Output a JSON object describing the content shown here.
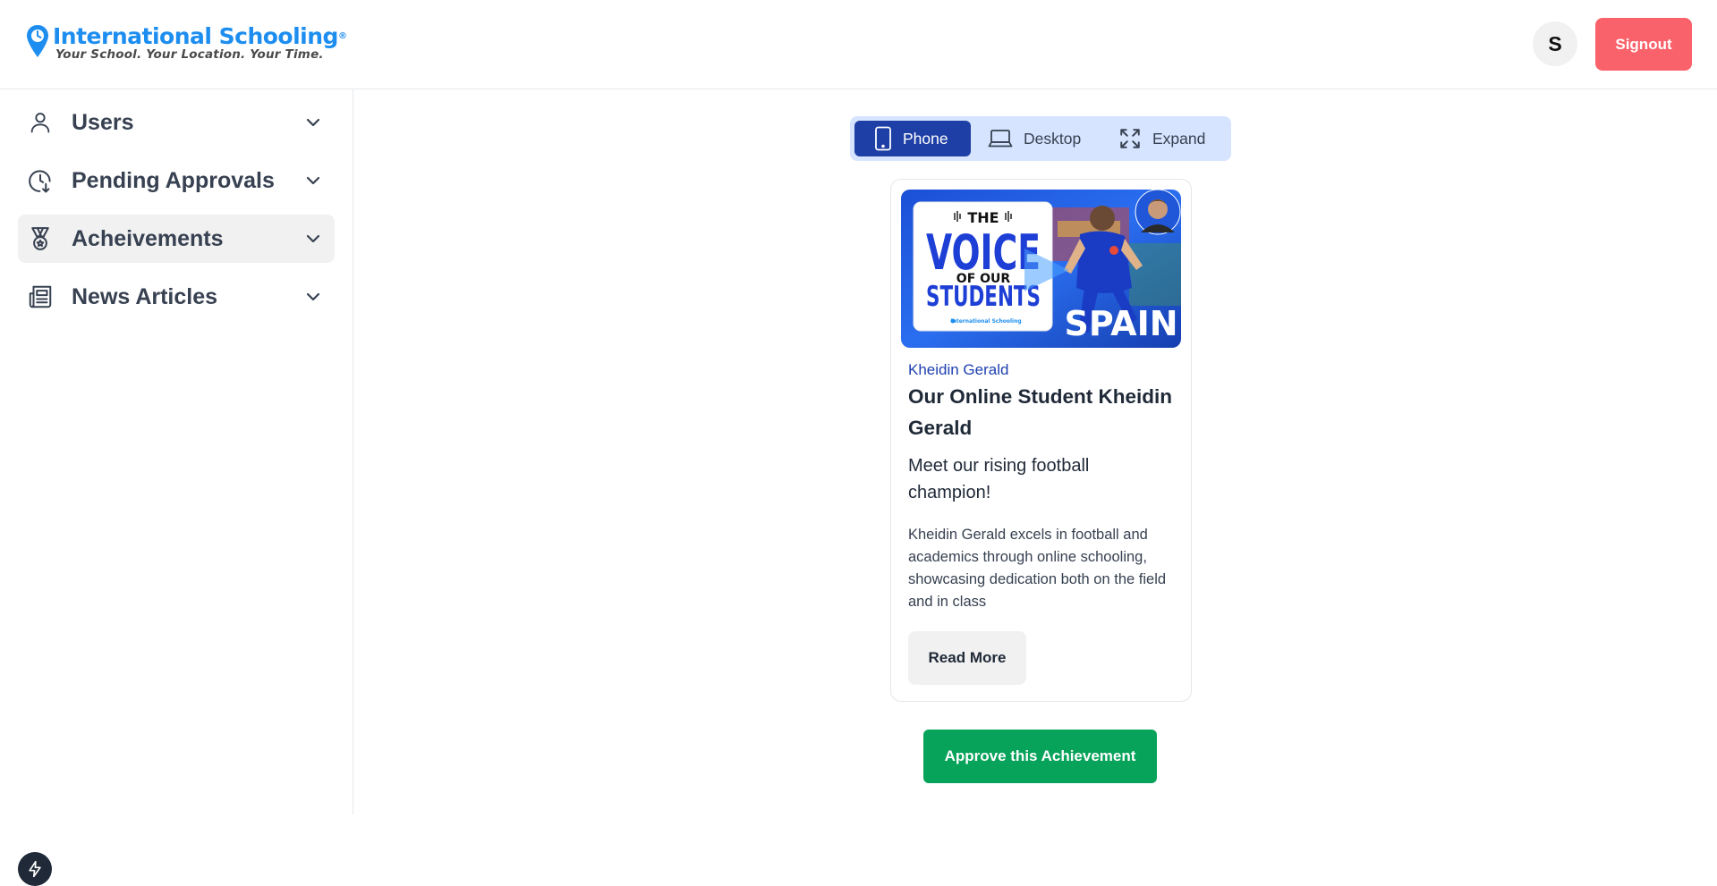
{
  "brand": {
    "name": "International Schooling",
    "registered": "®",
    "tagline": "Your School. Your Location. Your Time."
  },
  "header": {
    "avatar_initial": "S",
    "signout_label": "Signout"
  },
  "sidebar": {
    "items": [
      {
        "label": "Users",
        "icon": "user-icon",
        "active": false
      },
      {
        "label": "Pending Approvals",
        "icon": "clock-download-icon",
        "active": false
      },
      {
        "label": "Acheivements",
        "icon": "medal-icon",
        "active": true
      },
      {
        "label": "News Articles",
        "icon": "newspaper-icon",
        "active": false
      }
    ]
  },
  "view_toggle": {
    "options": [
      {
        "label": "Phone",
        "icon": "phone-icon",
        "active": true
      },
      {
        "label": "Desktop",
        "icon": "laptop-icon",
        "active": false
      },
      {
        "label": "Expand",
        "icon": "expand-icon",
        "active": false
      }
    ]
  },
  "card": {
    "thumbnail": {
      "line1": "THE",
      "line2": "VOICE",
      "line3": "OF OUR",
      "line4": "STUDENTS",
      "country": "SPAIN",
      "brand_small": "International Schooling"
    },
    "author": "Kheidin Gerald",
    "title": "Our Online Student Kheidin Gerald",
    "subtitle": "Meet our rising football champion!",
    "description": "Kheidin Gerald excels in football and academics through online schooling, showcasing dedication both on the field and in class",
    "read_more_label": "Read More"
  },
  "approve_label": "Approve this Achievement",
  "colors": {
    "brand_blue": "#1d8ef0",
    "signout": "#f9626b",
    "toggle_bg": "#d6e4ff",
    "toggle_active": "#1e3fa6",
    "author_link": "#1e40af",
    "approve": "#07a35a"
  }
}
